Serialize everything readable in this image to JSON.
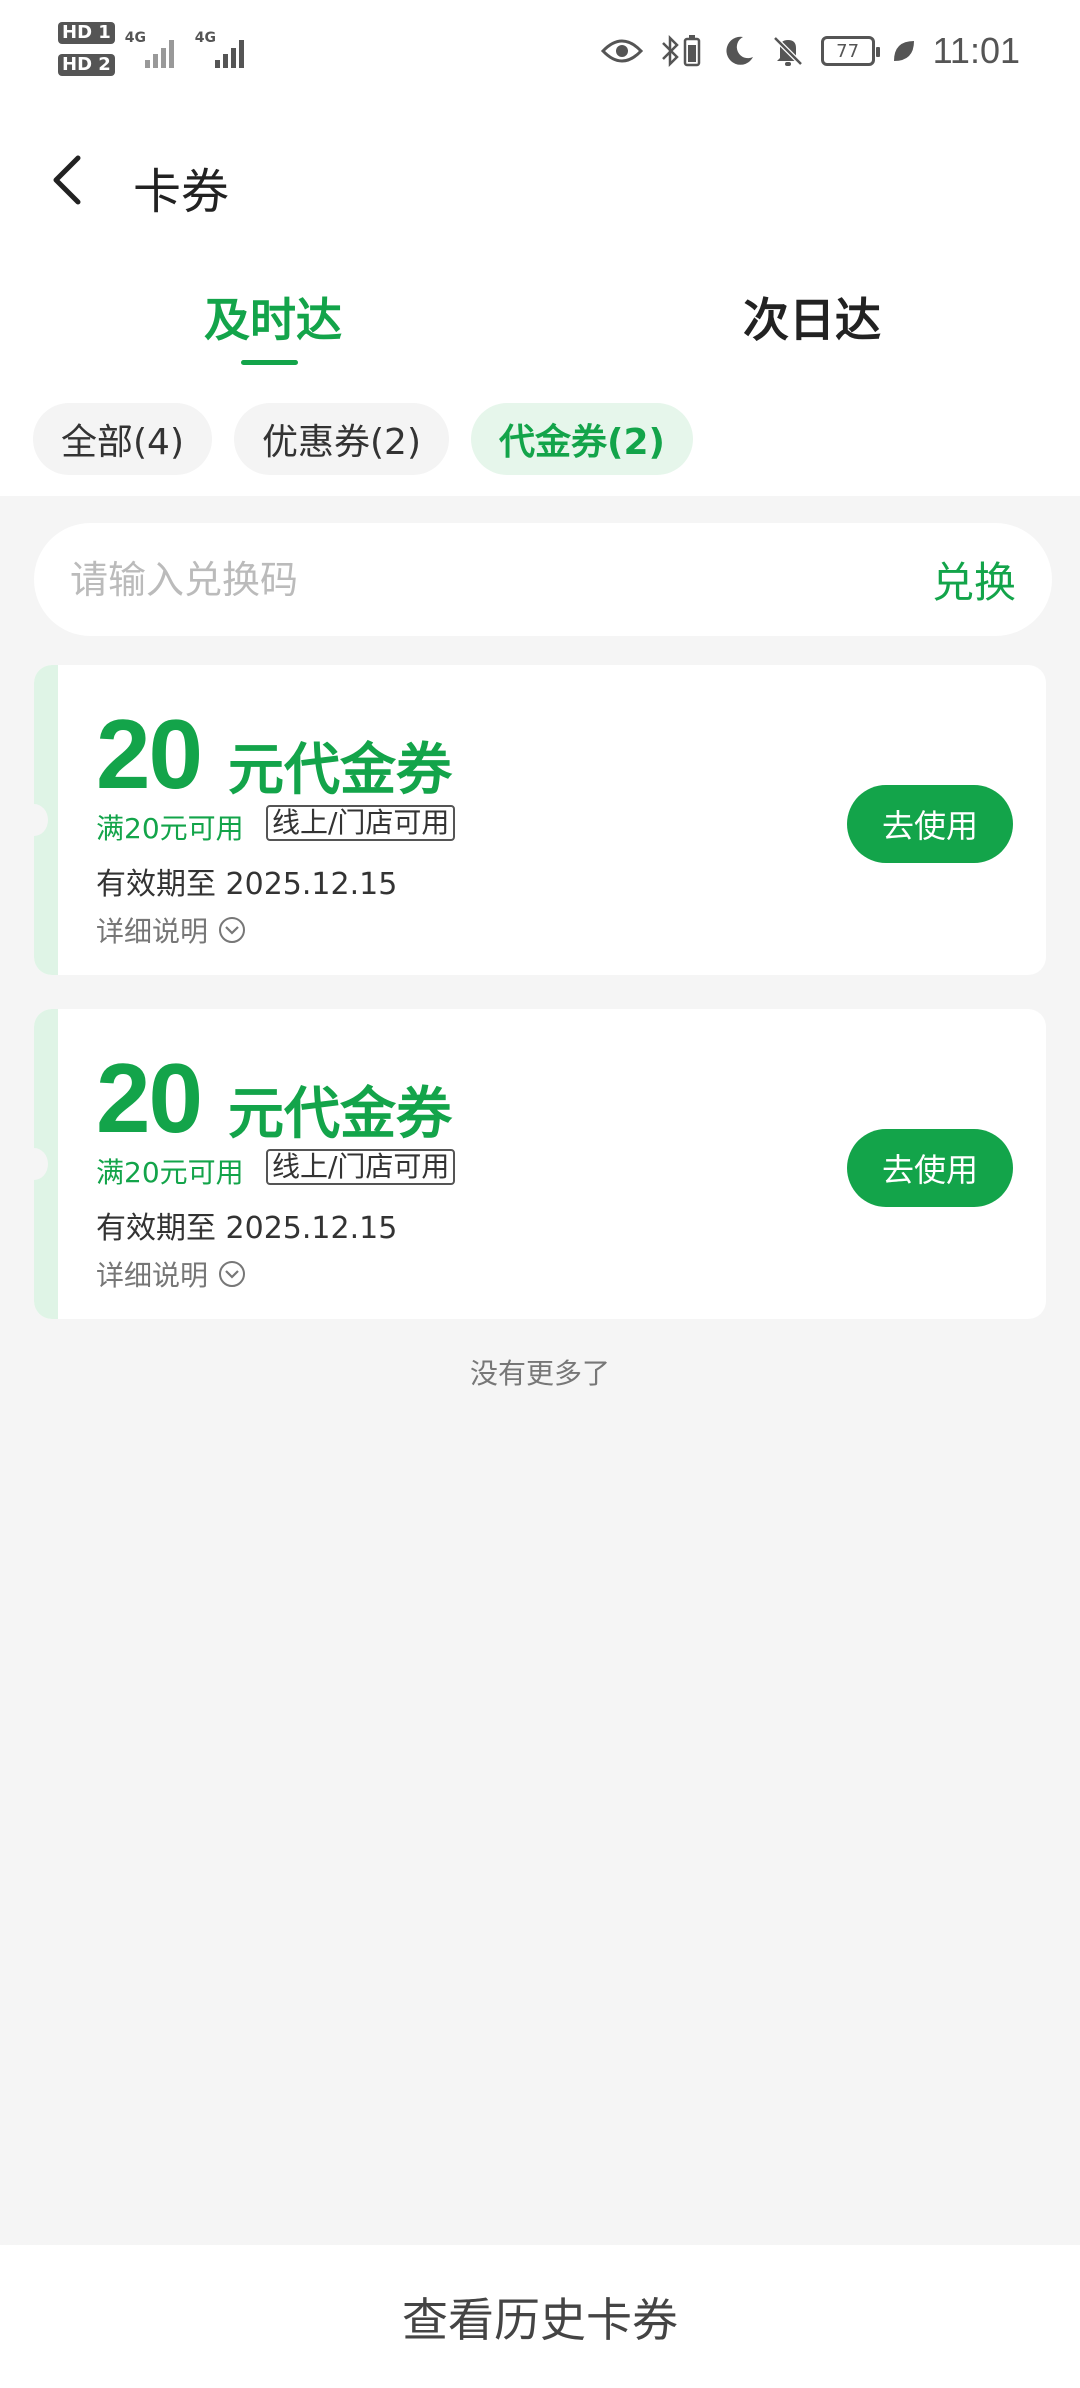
{
  "status_bar": {
    "sim1": "HD 1",
    "sim2": "HD 2",
    "net1": "4G",
    "net2": "4G",
    "battery": "77",
    "time": "11:01"
  },
  "header": {
    "title": "卡券"
  },
  "tabs": [
    {
      "label": "及时达",
      "active": true
    },
    {
      "label": "次日达",
      "active": false
    }
  ],
  "filters": [
    {
      "label": "全部(4)",
      "active": false
    },
    {
      "label": "优惠券(2)",
      "active": false
    },
    {
      "label": "代金券(2)",
      "active": true
    }
  ],
  "redeem": {
    "placeholder": "请输入兑换码",
    "button": "兑换"
  },
  "coupons": [
    {
      "amount": "20",
      "type": "元代金券",
      "condition": "满20元可用",
      "tag": "线上/门店可用",
      "validity": "有效期至 2025.12.15",
      "detail": "详细说明",
      "button": "去使用"
    },
    {
      "amount": "20",
      "type": "元代金券",
      "condition": "满20元可用",
      "tag": "线上/门店可用",
      "validity": "有效期至 2025.12.15",
      "detail": "详细说明",
      "button": "去使用"
    }
  ],
  "end_text": "没有更多了",
  "footer": {
    "history": "查看历史卡券"
  },
  "colors": {
    "accent": "#13a44a",
    "accent_light": "#e6f6eb",
    "background": "#f5f5f5"
  }
}
